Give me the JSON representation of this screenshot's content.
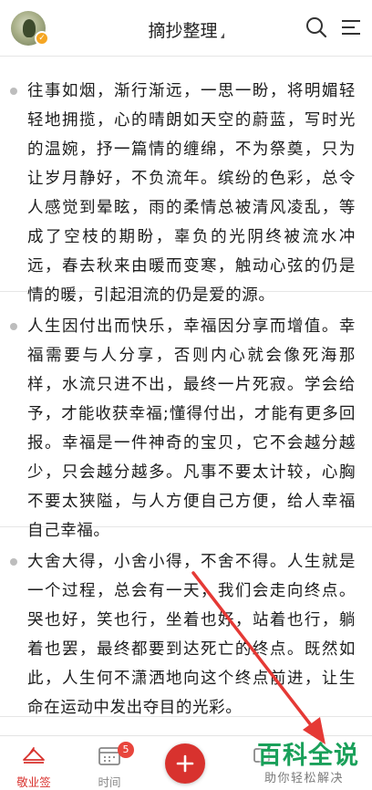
{
  "header": {
    "title": "摘抄整理"
  },
  "entries": [
    {
      "text": "往事如烟，渐行渐远，一思一盼，将明媚轻轻地拥揽，心的晴朗如天空的蔚蓝，写时光的温婉，抒一篇情的缠绵，不为祭奠，只为让岁月静好，不负流年。缤纷的色彩，总令人感觉到晕眩，雨的柔情总被清风凌乱，等成了空枝的期盼，辜负的光阴终被流水冲远，春去秋来由暖而变寒，触动心弦的仍是情的暖，引起泪流的仍是爱的源。"
    },
    {
      "text": "人生因付出而快乐，幸福因分享而增值。幸福需要与人分享，否则内心就会像死海那样，水流只进不出，最终一片死寂。学会给予，才能收获幸福;懂得付出，才能有更多回报。幸福是一件神奇的宝贝，它不会越分越少，只会越分越多。凡事不要太计较，心胸不要太狭隘，与人方便自己方便，给人幸福自己幸福。"
    },
    {
      "text": "大舍大得，小舍小得，不舍不得。人生就是一个过程，总会有一天，我们会走向终点。哭也好，笑也行，坐着也好，站着也行，躺着也罢，最终都要到达死亡的终点。既然如此，人生何不潇洒地向这个终点前进，让生命在运动中发出夺目的光彩。"
    }
  ],
  "tabbar": {
    "tabs": [
      {
        "label": "敬业签"
      },
      {
        "label": "时间",
        "badge": "5"
      }
    ]
  },
  "watermark": {
    "main": "百科全说",
    "sub": "助你轻松解决"
  },
  "colors": {
    "accent": "#d8322e",
    "badge": "#e8453c",
    "watermark": "#1aa05a",
    "arrow": "#e53935"
  }
}
